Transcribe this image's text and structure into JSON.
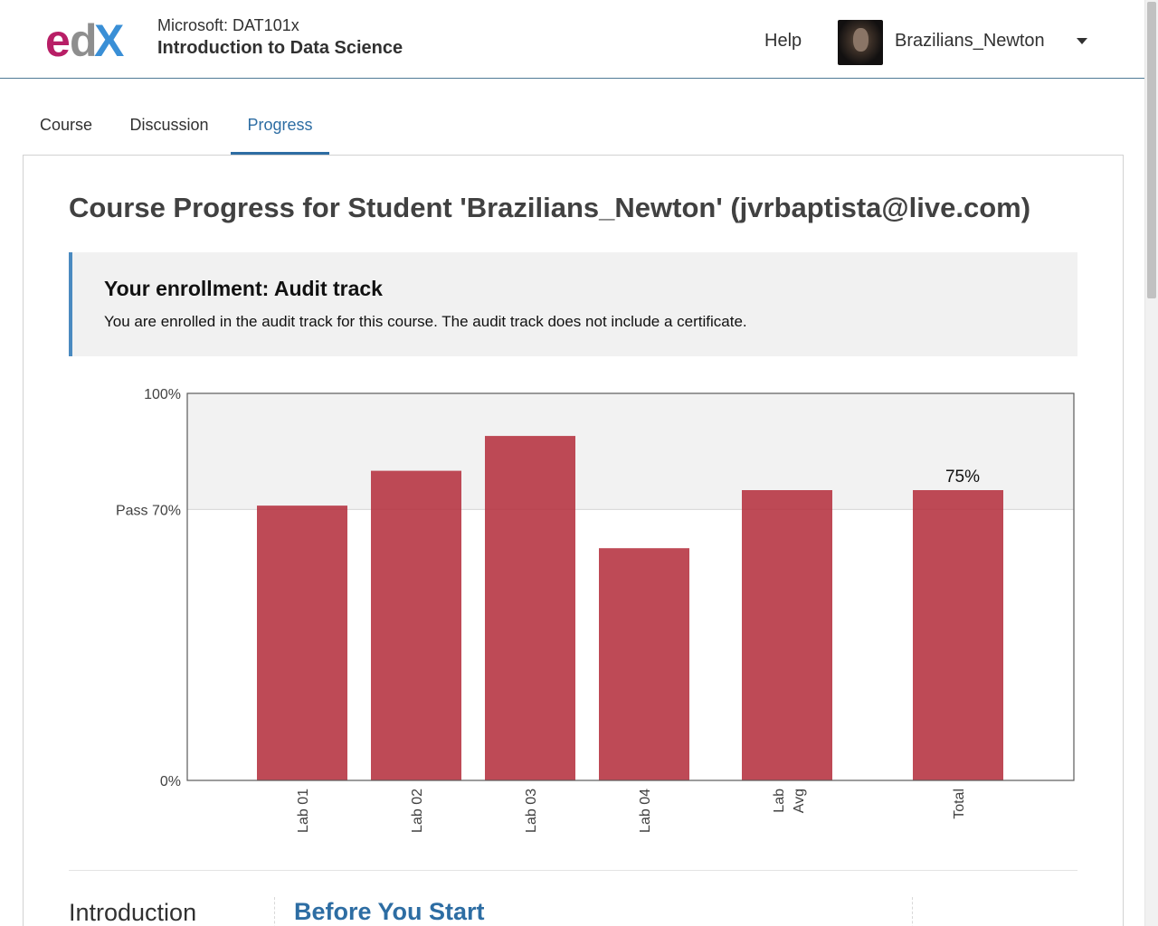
{
  "header": {
    "course_org": "Microsoft: DAT101x",
    "course_name": "Introduction to Data Science",
    "help_label": "Help",
    "username": "Brazilians_Newton"
  },
  "tabs": [
    {
      "label": "Course",
      "active": false
    },
    {
      "label": "Discussion",
      "active": false
    },
    {
      "label": "Progress",
      "active": true
    }
  ],
  "progress": {
    "title": "Course Progress for Student 'Brazilians_Newton' (jvrbaptista@live.com)",
    "enrollment_title": "Your enrollment: Audit track",
    "enrollment_text": "You are enrolled in the audit track for this course. The audit track does not include a certificate."
  },
  "colors": {
    "accent": "#2d6da3",
    "bar": "#b5313f",
    "enroll_border": "#4a8ac0"
  },
  "chart_data": {
    "type": "bar",
    "categories": [
      "Lab 01",
      "Lab 02",
      "Lab 03",
      "Lab 04",
      "Lab Avg",
      "Total"
    ],
    "category_lines": [
      [
        "Lab 01"
      ],
      [
        "Lab 02"
      ],
      [
        "Lab 03"
      ],
      [
        "Lab 04"
      ],
      [
        "Lab",
        "Avg"
      ],
      [
        "Total"
      ]
    ],
    "values": [
      71,
      80,
      89,
      60,
      75,
      75
    ],
    "ylim": [
      0,
      100
    ],
    "y_ticks": [
      {
        "value": 100,
        "label": "100%"
      },
      {
        "value": 70,
        "label": "Pass 70%"
      },
      {
        "value": 0,
        "label": "0%"
      }
    ],
    "pass_value": 70,
    "value_labels": [
      {
        "category": "Total",
        "label": "75%"
      }
    ],
    "grid": false,
    "legend": "none"
  },
  "section": {
    "chapter_name": "Introduction",
    "subsection_name": "Before You Start"
  }
}
